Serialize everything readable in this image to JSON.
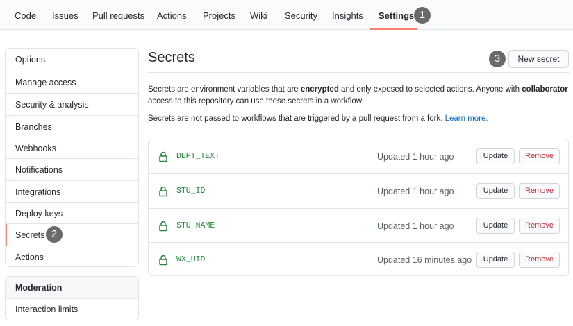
{
  "nav": {
    "tabs": [
      "Code",
      "Issues",
      "Pull requests",
      "Actions",
      "Projects",
      "Wiki",
      "Security",
      "Insights",
      "Settings"
    ],
    "active_tab": "Settings"
  },
  "annotations": [
    "1",
    "2",
    "3"
  ],
  "sidebar": {
    "items": [
      "Options",
      "Manage access",
      "Security & analysis",
      "Branches",
      "Webhooks",
      "Notifications",
      "Integrations",
      "Deploy keys",
      "Secrets",
      "Actions"
    ],
    "selected": "Secrets"
  },
  "moderation": {
    "heading": "Moderation",
    "items": [
      "Interaction limits"
    ]
  },
  "main": {
    "title": "Secrets",
    "new_secret_label": "New secret",
    "desc1": {
      "part1": "Secrets are environment variables that are ",
      "bold1": "encrypted",
      "part2": " and only exposed to selected actions. Anyone with ",
      "bold2": "collaborator",
      "part3": " access to this repository can use these secrets in a workflow."
    },
    "desc2": {
      "text": "Secrets are not passed to workflows that are triggered by a pull request from a fork. ",
      "link": "Learn more."
    }
  },
  "secrets": [
    {
      "name": "DEPT_TEXT",
      "updated": "Updated 1 hour ago",
      "update_label": "Update",
      "remove_label": "Remove"
    },
    {
      "name": "STU_ID",
      "updated": "Updated 1 hour ago",
      "update_label": "Update",
      "remove_label": "Remove"
    },
    {
      "name": "STU_NAME",
      "updated": "Updated 1 hour ago",
      "update_label": "Update",
      "remove_label": "Remove"
    },
    {
      "name": "WX_UID",
      "updated": "Updated 16 minutes ago",
      "update_label": "Update",
      "remove_label": "Remove"
    }
  ],
  "colors": {
    "accent": "#f9826c",
    "secret_name": "#22863a",
    "danger": "#cb2431",
    "link": "#0366d6",
    "badge": "#6a6a6a"
  },
  "icons": {
    "secret": "lock-icon"
  }
}
